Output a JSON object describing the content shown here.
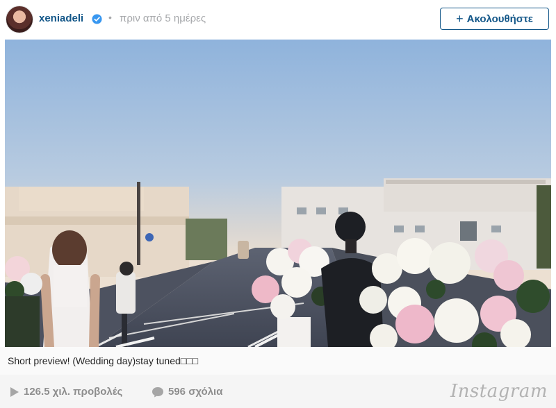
{
  "header": {
    "username": "xeniadeli",
    "separator": "•",
    "timestamp": "πριν από 5 ημέρες",
    "follow_label": "Ακολουθήστε",
    "follow_plus": "+"
  },
  "media": {
    "type": "video-frame"
  },
  "caption": {
    "text": "Short preview! (Wedding day)stay tuned□□□"
  },
  "footer": {
    "views": "126.5 χιλ. προβολές",
    "comments": "596 σχόλια",
    "brand": "Instagram"
  },
  "colors": {
    "accent": "#125688",
    "muted": "#a5a7aa",
    "verified": "#3897f0",
    "footer_bg": "#f5f5f5"
  }
}
